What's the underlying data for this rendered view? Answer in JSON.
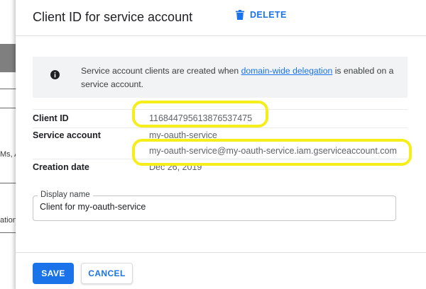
{
  "background": {
    "fragment_ms": "Ms, A",
    "fragment_ation": "ation"
  },
  "dialog": {
    "title": "Client ID for service account",
    "delete_label": "DELETE",
    "info": {
      "text_before": "Service account clients are created when ",
      "link_text": "domain-wide delegation",
      "text_after": " is enabled on a service account."
    },
    "fields": {
      "client_id_label": "Client ID",
      "client_id_value": "116844795613876537475",
      "service_account_label": "Service account",
      "service_account_name": "my-oauth-service",
      "service_account_email": "my-oauth-service@my-oauth-service.iam.gserviceaccount.com",
      "creation_date_label": "Creation date",
      "creation_date_value": "Dec 26, 2019"
    },
    "display_name": {
      "label": "Display name",
      "value": "Client for my-oauth-service"
    },
    "save_label": "SAVE",
    "cancel_label": "CANCEL"
  },
  "colors": {
    "accent": "#1a73e8",
    "highlight": "#f5ee1a"
  }
}
